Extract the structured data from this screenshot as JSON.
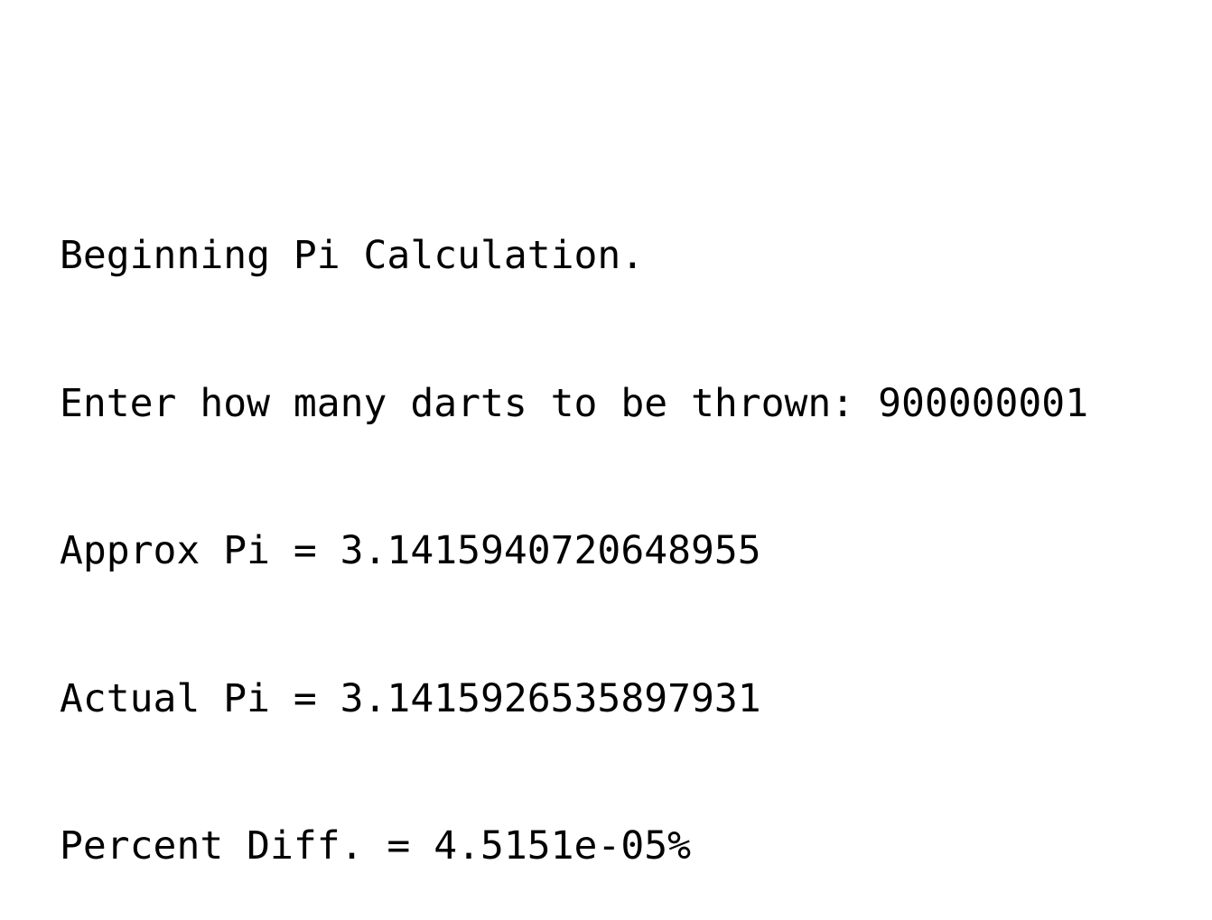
{
  "console": {
    "lines": [
      "Beginning Pi Calculation.",
      "Enter how many darts to be thrown: 900000001",
      "Approx Pi = 3.1415940720648955",
      "Actual Pi = 3.1415926535897931",
      "Percent Diff. = 4.5151e-05%"
    ]
  },
  "colors": {
    "background": "#ffffff",
    "text": "#000000"
  }
}
